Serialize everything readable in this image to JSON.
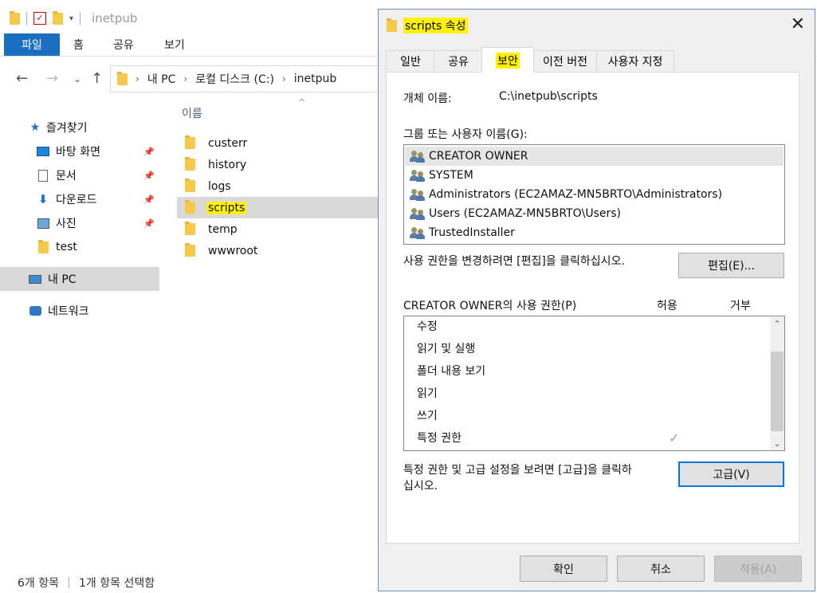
{
  "explorer": {
    "title": "inetpub",
    "ribbon": {
      "file": "파일",
      "tabs": [
        "홈",
        "공유",
        "보기"
      ]
    },
    "address": {
      "parts": [
        "내 PC",
        "로컬 디스크 (C:)",
        "inetpub"
      ]
    },
    "sidebar": {
      "quick_access": "즐겨찾기",
      "items": [
        "바탕 화면",
        "문서",
        "다운로드",
        "사진",
        "test"
      ],
      "this_pc": "내 PC",
      "network": "네트워크"
    },
    "filelist": {
      "column": "이름",
      "files": [
        "custerr",
        "history",
        "logs",
        "scripts",
        "temp",
        "wwwroot"
      ],
      "selected": "scripts"
    },
    "status": {
      "count": "6개 항목",
      "selected": "1개 항목 선택함"
    }
  },
  "dialog": {
    "title": "scripts 속성",
    "tabs": [
      "일반",
      "공유",
      "보안",
      "이전 버전",
      "사용자 지정"
    ],
    "active_tab": "보안",
    "object_name_label": "개체 이름:",
    "object_name_value": "C:\\inetpub\\scripts",
    "group_label": "그룹 또는 사용자 이름(G):",
    "users": [
      "CREATOR OWNER",
      "SYSTEM",
      "Administrators (EC2AMAZ-MN5BRTO\\Administrators)",
      "Users (EC2AMAZ-MN5BRTO\\Users)",
      "TrustedInstaller"
    ],
    "edit_hint": "사용 권한을 변경하려면 [편집]을 클릭하십시오.",
    "edit_button": "편집(E)...",
    "perm_header": "CREATOR OWNER의 사용 권한(P)",
    "allow_header": "허용",
    "deny_header": "거부",
    "permissions": [
      "수정",
      "읽기 및 실행",
      "폴더 내용 보기",
      "읽기",
      "쓰기",
      "특정 권한"
    ],
    "check_glyph": "✓",
    "advanced_hint_1": "특정 권한 및 고급 설정을 보려면 [고급]을 클릭하",
    "advanced_hint_2": "십시오.",
    "advanced_button": "고급(V)",
    "ok": "확인",
    "cancel": "취소",
    "apply": "적용(A)",
    "close_glyph": "✕"
  }
}
